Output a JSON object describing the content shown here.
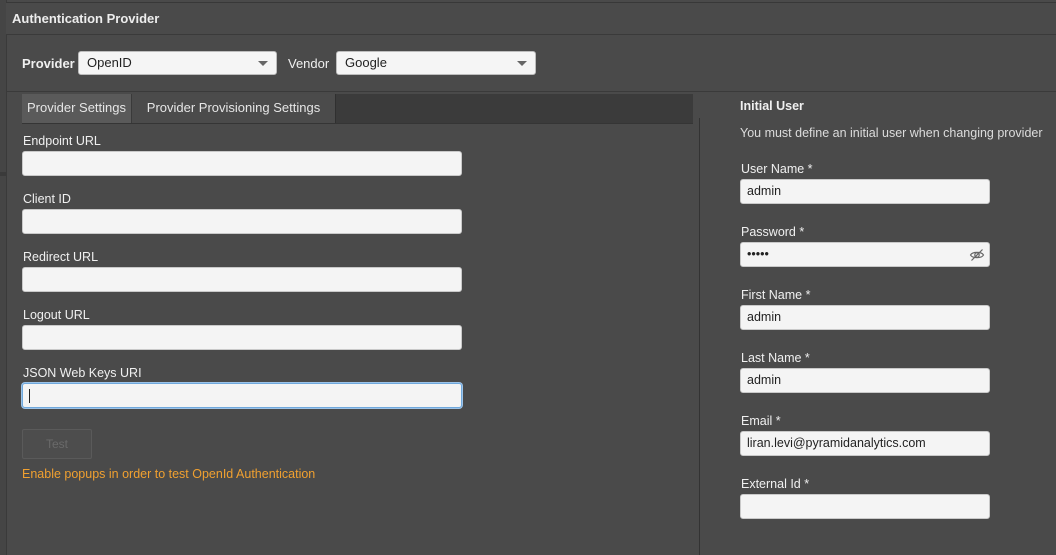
{
  "window": {
    "title": "Authentication Provider"
  },
  "provider": {
    "provider_label": "Provider",
    "provider_value": "OpenID",
    "vendor_label": "Vendor",
    "vendor_value": "Google"
  },
  "tabs": [
    {
      "label": "Provider Settings",
      "active": true
    },
    {
      "label": "Provider Provisioning Settings",
      "active": false
    }
  ],
  "settings_fields": [
    {
      "label": "Endpoint URL",
      "value": ""
    },
    {
      "label": "Client ID",
      "value": ""
    },
    {
      "label": "Redirect URL",
      "value": ""
    },
    {
      "label": "Logout URL",
      "value": ""
    },
    {
      "label": "JSON Web Keys URI",
      "value": ""
    }
  ],
  "test_button": "Test",
  "warning": "Enable popups in order to test OpenId Authentication",
  "initial_user": {
    "title": "Initial User",
    "description": "You must define an initial user when changing provider",
    "fields": [
      {
        "label": "User Name *",
        "value": "admin"
      },
      {
        "label": "Password *",
        "value": "•••••"
      },
      {
        "label": "First Name *",
        "value": "admin"
      },
      {
        "label": "Last Name *",
        "value": "admin"
      },
      {
        "label": "Email *",
        "value": "liran.levi@pyramidanalytics.com"
      },
      {
        "label": "External Id *",
        "value": ""
      }
    ]
  },
  "colors": {
    "background": "#4a4a4a",
    "warning": "#f0a030",
    "focus": "#6fa8dc"
  },
  "icons": {
    "select_caret": "chevron-down-icon",
    "password_toggle": "eye-slash-icon"
  }
}
